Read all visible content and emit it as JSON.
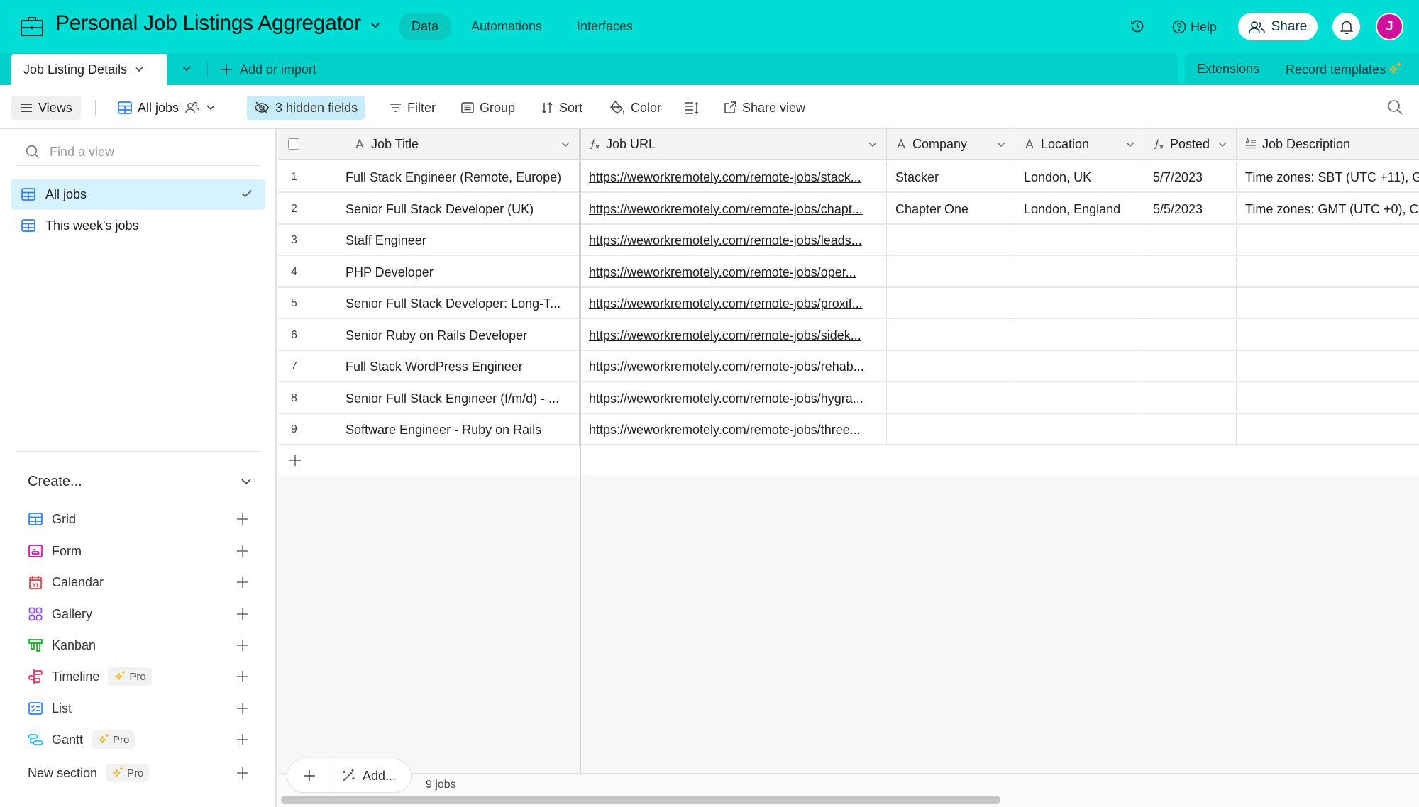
{
  "app": {
    "base_title": "Personal Job Listings Aggregator",
    "nav": [
      {
        "label": "Data",
        "active": true
      },
      {
        "label": "Automations",
        "active": false
      },
      {
        "label": "Interfaces",
        "active": false
      }
    ],
    "help_label": "Help",
    "share_label": "Share",
    "avatar_initial": "J",
    "colors": {
      "header_bg": "#00ddd4",
      "avatar": "#d0109d",
      "active_view": "#d6f2fd",
      "hidden_fields_bg": "#c7ecfa"
    }
  },
  "tabs": {
    "active_table": "Job Listing Details",
    "add_import_label": "Add or import",
    "extensions_label": "Extensions",
    "record_templates_label": "Record templates"
  },
  "toolbar": {
    "views_label": "Views",
    "current_view": "All jobs",
    "hidden_fields_label": "3 hidden fields",
    "filter_label": "Filter",
    "group_label": "Group",
    "sort_label": "Sort",
    "color_label": "Color",
    "share_view_label": "Share view"
  },
  "sidebar": {
    "find_placeholder": "Find a view",
    "views": [
      {
        "label": "All jobs",
        "icon": "grid-icon",
        "active": true
      },
      {
        "label": "This week's jobs",
        "icon": "grid-icon",
        "active": false
      }
    ],
    "create_label": "Create...",
    "create_items": [
      {
        "label": "Grid",
        "icon": "grid-icon",
        "pro": false
      },
      {
        "label": "Form",
        "icon": "form-icon",
        "pro": false
      },
      {
        "label": "Calendar",
        "icon": "calendar-icon",
        "pro": false
      },
      {
        "label": "Gallery",
        "icon": "gallery-icon",
        "pro": false
      },
      {
        "label": "Kanban",
        "icon": "kanban-icon",
        "pro": false
      },
      {
        "label": "Timeline",
        "icon": "timeline-icon",
        "pro": true
      },
      {
        "label": "List",
        "icon": "list-icon",
        "pro": false
      },
      {
        "label": "Gantt",
        "icon": "gantt-icon",
        "pro": true
      }
    ],
    "new_section_label": "New section",
    "pro_label": "Pro"
  },
  "grid": {
    "columns": [
      {
        "key": "title",
        "label": "Job Title",
        "type": "text"
      },
      {
        "key": "url",
        "label": "Job URL",
        "type": "formula"
      },
      {
        "key": "company",
        "label": "Company",
        "type": "text"
      },
      {
        "key": "location",
        "label": "Location",
        "type": "text"
      },
      {
        "key": "posted",
        "label": "Posted",
        "type": "formula"
      },
      {
        "key": "desc",
        "label": "Job Description",
        "type": "long-text"
      }
    ],
    "rows": [
      {
        "num": "1",
        "title": "Full Stack Engineer (Remote, Europe)",
        "url": "https://weworkremotely.com/remote-jobs/stack...",
        "company": "Stacker",
        "location": "London, UK",
        "posted": "5/7/2023",
        "desc": "Time zones: SBT (UTC +11), G"
      },
      {
        "num": "2",
        "title": "Senior Full Stack Developer (UK)",
        "url": "https://weworkremotely.com/remote-jobs/chapt...",
        "company": "Chapter One",
        "location": "London, England",
        "posted": "5/5/2023",
        "desc": "Time zones: GMT (UTC +0), C"
      },
      {
        "num": "3",
        "title": "Staff Engineer",
        "url": "https://weworkremotely.com/remote-jobs/leads...",
        "company": "",
        "location": "",
        "posted": "",
        "desc": ""
      },
      {
        "num": "4",
        "title": "PHP Developer",
        "url": "https://weworkremotely.com/remote-jobs/oper...",
        "company": "",
        "location": "",
        "posted": "",
        "desc": ""
      },
      {
        "num": "5",
        "title": "Senior Full Stack Developer: Long-T...",
        "url": "https://weworkremotely.com/remote-jobs/proxif...",
        "company": "",
        "location": "",
        "posted": "",
        "desc": ""
      },
      {
        "num": "6",
        "title": "Senior Ruby on Rails Developer",
        "url": "https://weworkremotely.com/remote-jobs/sidek...",
        "company": "",
        "location": "",
        "posted": "",
        "desc": ""
      },
      {
        "num": "7",
        "title": "Full Stack WordPress Engineer",
        "url": "https://weworkremotely.com/remote-jobs/rehab...",
        "company": "",
        "location": "",
        "posted": "",
        "desc": ""
      },
      {
        "num": "8",
        "title": "Senior Full Stack Engineer (f/m/d) - ...",
        "url": "https://weworkremotely.com/remote-jobs/hygra...",
        "company": "",
        "location": "",
        "posted": "",
        "desc": ""
      },
      {
        "num": "9",
        "title": "Software Engineer - Ruby on Rails",
        "url": "https://weworkremotely.com/remote-jobs/three...",
        "company": "",
        "location": "",
        "posted": "",
        "desc": ""
      }
    ],
    "add_label": "Add...",
    "record_count": "9 jobs"
  }
}
